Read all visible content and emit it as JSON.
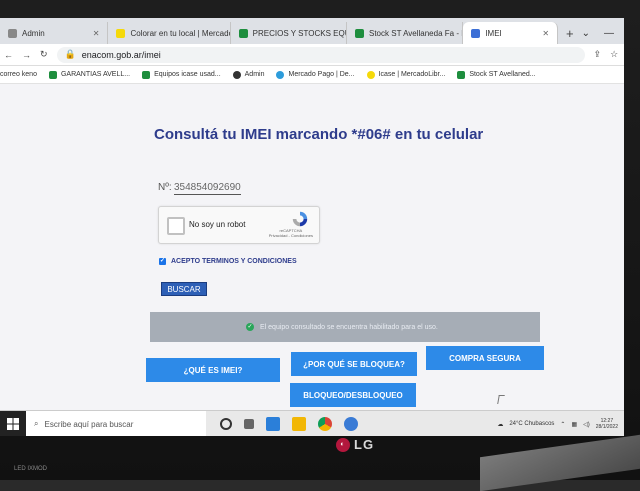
{
  "browser": {
    "tabs": [
      {
        "label": "Admin",
        "color": "#888888",
        "active": false
      },
      {
        "label": "Colorar en tu local | Mercado...",
        "color": "#f5d90a",
        "active": false
      },
      {
        "label": "PRECIOS Y STOCKS EQUIP...",
        "color": "#1e8e3e",
        "active": false
      },
      {
        "label": "Stock ST Avellaneda Fa - Ho...",
        "color": "#1e8e3e",
        "active": false
      },
      {
        "label": "IMEI",
        "color": "#3c6fd6",
        "active": true
      }
    ],
    "url": "enacom.gob.ar/imei",
    "bookmarks": [
      {
        "label": "correo keno",
        "color": "#cccccc"
      },
      {
        "label": "GARANTIAS AVELL...",
        "color": "#1e8e3e"
      },
      {
        "label": "Equipos icase usad...",
        "color": "#1e8e3e"
      },
      {
        "label": "Admin",
        "color": "#333333"
      },
      {
        "label": "Mercado Pago | De...",
        "color": "#2d9cdb"
      },
      {
        "label": "Icase | MercadoLibr...",
        "color": "#f5d90a"
      },
      {
        "label": "Stock ST Avellaned...",
        "color": "#1e8e3e"
      }
    ]
  },
  "page": {
    "title": "Consultá tu IMEI marcando *#06# en tu celular",
    "imei_prefix": "Nº:",
    "imei_value": "354854092690",
    "captcha_label": "No soy un robot",
    "captcha_brand": "reCAPTCHA",
    "captcha_links": "Privacidad - Condiciones",
    "terms_label": "ACEPTO TERMINOS Y CONDICIONES",
    "search_button": "BUSCAR",
    "status_message": "El equipo consultado se encuentra habilitado para el uso.",
    "buttons": {
      "what_is_imei": "¿QUÉ ES IMEI?",
      "why_blocked": "¿POR QUÉ SE BLOQUEA?",
      "safe_purchase": "COMPRA SEGURA",
      "block_unblock": "BLOQUEO/DESBLOQUEO"
    },
    "colors": {
      "title": "#2e3c8c",
      "button": "#2d8ae8",
      "status_bg": "#a6adb6"
    }
  },
  "taskbar": {
    "search_placeholder": "Escribe aquí para buscar",
    "weather": "24°C  Chubascos",
    "time": "12:27",
    "date": "28/1/2022"
  },
  "monitor": {
    "brand": "LG",
    "label": "LED  IXMOD"
  }
}
